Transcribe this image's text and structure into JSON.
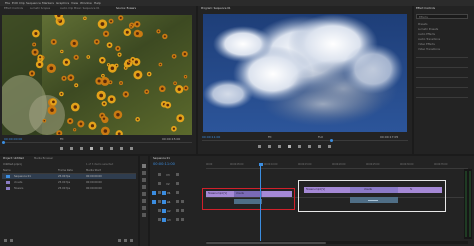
{
  "menu": {
    "items": [
      "File",
      "Edit",
      "Clip",
      "Sequence",
      "Markers",
      "Graphics",
      "View",
      "Window",
      "Help"
    ]
  },
  "source_monitor": {
    "tabs": [
      "Effect Controls",
      "Lumetri Scopes",
      "Audio Clip Mixer: Sequence 01",
      "Source: flowers"
    ],
    "timecode_left": "00:00:00:00",
    "fit_label": "Fit",
    "timecode_right": "00:00:15:00",
    "image_desc": "flowers"
  },
  "program_monitor": {
    "tab": "Program: Sequence 01",
    "timecode_left": "00:00:11:00",
    "fit_label": "Fit",
    "quality": "Full",
    "timecode_right": "00:00:17:05"
  },
  "effects_panel": {
    "title": "Effect Controls",
    "search_placeholder": "Effects",
    "items": [
      "Presets",
      "Lumetri Presets",
      "Audio Effects",
      "Audio Transitions",
      "Video Effects",
      "Video Transitions"
    ]
  },
  "project_panel": {
    "tabs": [
      "Project: Untitled",
      "Media Browser"
    ],
    "project_name": "Untitled.prproj",
    "item_count": "1 of 3 items selected",
    "columns": [
      "Name",
      "Frame Rate",
      "Media Start"
    ],
    "rows": [
      {
        "name": "Sequence 01",
        "rate": "25.00 fps",
        "start": "00:00:00:00"
      },
      {
        "name": "clouds",
        "rate": "25.00 fps",
        "start": "00:00:00:00"
      },
      {
        "name": "flowers",
        "rate": "25.00 fps",
        "start": "00:00:00:00"
      }
    ]
  },
  "timeline": {
    "tab": "Sequence 01",
    "timecode": "00:00:11:00",
    "ruler": [
      "00:00",
      "00:00:05:00",
      "00:00:10:00",
      "00:00:15:00",
      "00:00:20:00",
      "00:00:25:00",
      "00:00:30:00",
      "00:00:35:00"
    ],
    "tracks": [
      "V3",
      "V2",
      "V1",
      "A1",
      "A2",
      "A3"
    ],
    "clips": {
      "left_v1": "flowers.mp4 [V]",
      "left_v1b": "clouds",
      "left_a1": "",
      "right_v1a": "flowers.mp4 [V]",
      "right_v1b": "clouds",
      "right_v1c": "fx"
    }
  },
  "colors": {
    "accent_blue": "#3b8de0",
    "highlight_red": "#d1202a",
    "highlight_white": "#e8e8e8",
    "video_clip": "#a589d6",
    "audio_clip": "#4f6e86"
  }
}
